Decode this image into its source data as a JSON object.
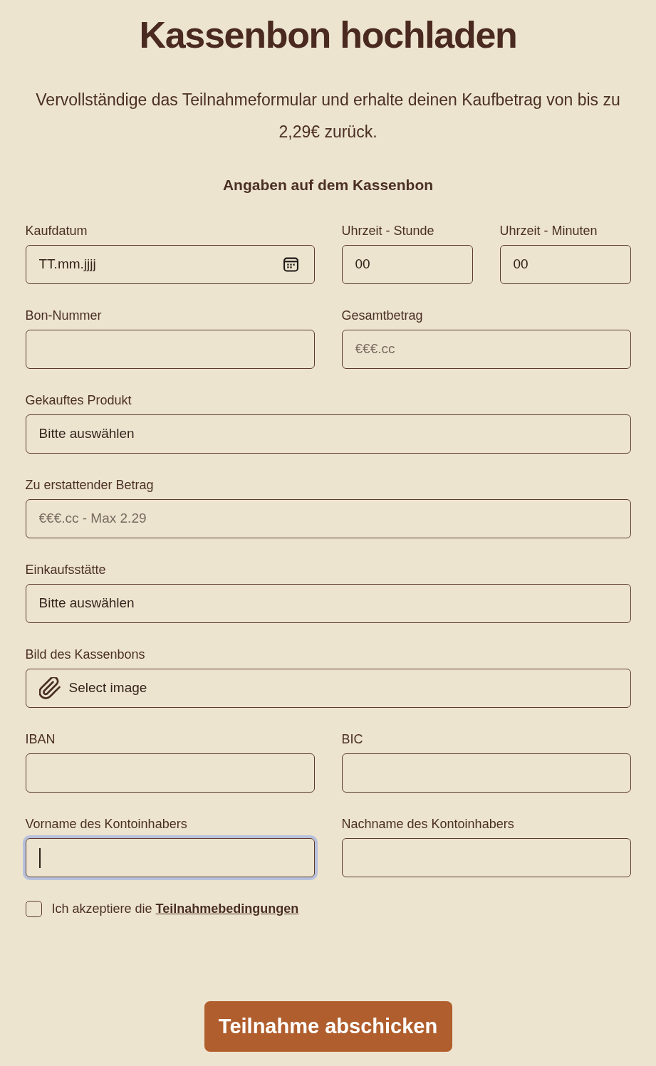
{
  "title": "Kassenbon hochladen",
  "intro": "Vervollständige das Teilnahmeformular und erhalte deinen Kaufbetrag von bis zu 2,29€ zurück.",
  "section_title": "Angaben auf dem Kassenbon",
  "rows": [
    {
      "fields": [
        {
          "label": "Kaufdatum",
          "kind": "date",
          "placeholder": "TT.mm.jjjj",
          "focused": false
        },
        {
          "label": "Uhrzeit - Stunde",
          "kind": "text",
          "value": "00",
          "focused": false
        },
        {
          "label": "Uhrzeit - Minuten",
          "kind": "text",
          "value": "00",
          "focused": false
        }
      ]
    },
    {
      "fields": [
        {
          "label": "Bon-Nummer",
          "kind": "text",
          "focused": false
        },
        {
          "label": "Gesamtbetrag",
          "kind": "text",
          "placeholder": "€€€.cc",
          "focused": false
        }
      ]
    },
    {
      "fields": [
        {
          "label": "Gekauftes Produkt",
          "kind": "select",
          "value": "Bitte auswählen",
          "focused": false
        }
      ]
    },
    {
      "fields": [
        {
          "label": "Zu erstattender Betrag",
          "kind": "text",
          "placeholder": "€€€.cc - Max 2.29",
          "focused": false
        }
      ]
    },
    {
      "fields": [
        {
          "label": "Einkaufsstätte",
          "kind": "select",
          "value": "Bitte auswählen",
          "focused": false
        }
      ]
    },
    {
      "fields": [
        {
          "label": "Bild des Kassenbons",
          "kind": "file",
          "button_label": "Select image",
          "focused": false
        }
      ]
    },
    {
      "fields": [
        {
          "label": "IBAN",
          "kind": "text",
          "focused": false
        },
        {
          "label": "BIC",
          "kind": "text",
          "focused": false
        }
      ]
    },
    {
      "fields": [
        {
          "label": "Vorname des Kontoinhabers",
          "kind": "text",
          "focused": true
        },
        {
          "label": "Nachname des Kontoinhabers",
          "kind": "text",
          "focused": false
        }
      ]
    }
  ],
  "consent": {
    "checked": false,
    "text": "Ich akzeptiere die",
    "link": "Teilnahmebedingungen"
  },
  "submit_button": "Teilnahme abschicken"
}
